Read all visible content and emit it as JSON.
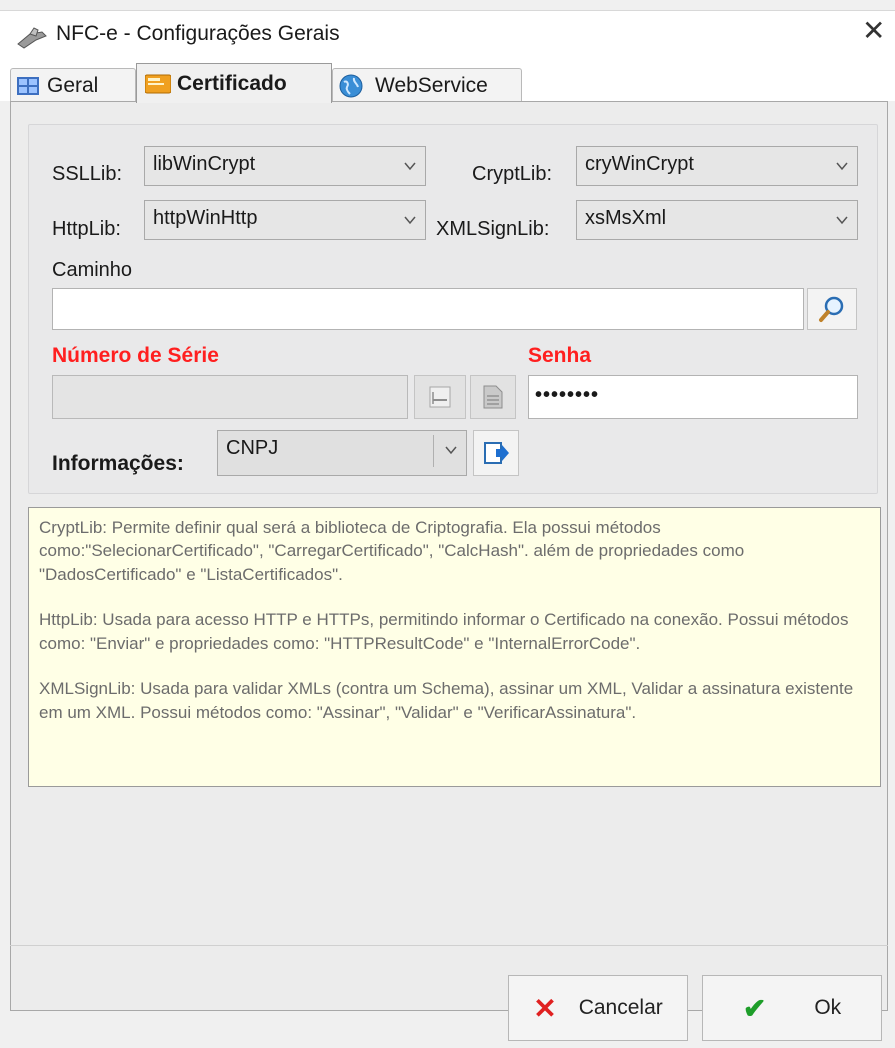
{
  "window": {
    "title": "NFC-e - Configurações Gerais",
    "close": "✕"
  },
  "tabs": [
    {
      "label": "Geral"
    },
    {
      "label": "Certificado"
    },
    {
      "label": "WebService"
    }
  ],
  "certificado": {
    "ssllib": {
      "label": "SSLLib:",
      "value": "libWinCrypt"
    },
    "cryptlib": {
      "label": "CryptLib:",
      "value": "cryWinCrypt"
    },
    "httplib": {
      "label": "HttpLib:",
      "value": "httpWinHttp"
    },
    "xmlsignlib": {
      "label": "XMLSignLib:",
      "value": "xsMsXml"
    },
    "caminho": {
      "label": "Caminho",
      "value": ""
    },
    "numero_serie": {
      "label": "Número de Série",
      "value": ""
    },
    "senha": {
      "label": "Senha",
      "value": "••••••••"
    },
    "informacoes": {
      "label": "Informações:",
      "value": "CNPJ"
    }
  },
  "help": {
    "p1": "CryptLib: Permite definir qual será a biblioteca de Criptografia. Ela possui métodos como:\"SelecionarCertificado\", \"CarregarCertificado\", \"CalcHash\". além de propriedades como \"DadosCertificado\" e \"ListaCertificados\".",
    "p2": "HttpLib: Usada para acesso HTTP  e HTTPs, permitindo informar o Certificado na conexão. Possui métodos como: \"Enviar\" e propriedades como: \"HTTPResultCode\" e \"InternalErrorCode\".",
    "p3": "XMLSignLib: Usada para validar XMLs (contra um Schema), assinar um XML, Validar a assinatura existente em um XML. Possui métodos como: \"Assinar\", \"Validar\" e \"VerificarAssinatura\"."
  },
  "buttons": {
    "cancel": "Cancelar",
    "ok": "Ok"
  },
  "colors": {
    "required_label": "#ff1f1f",
    "memo_bg": "#ffffe6",
    "cancel_icon": "#e02020",
    "ok_icon": "#1e9e2a"
  }
}
